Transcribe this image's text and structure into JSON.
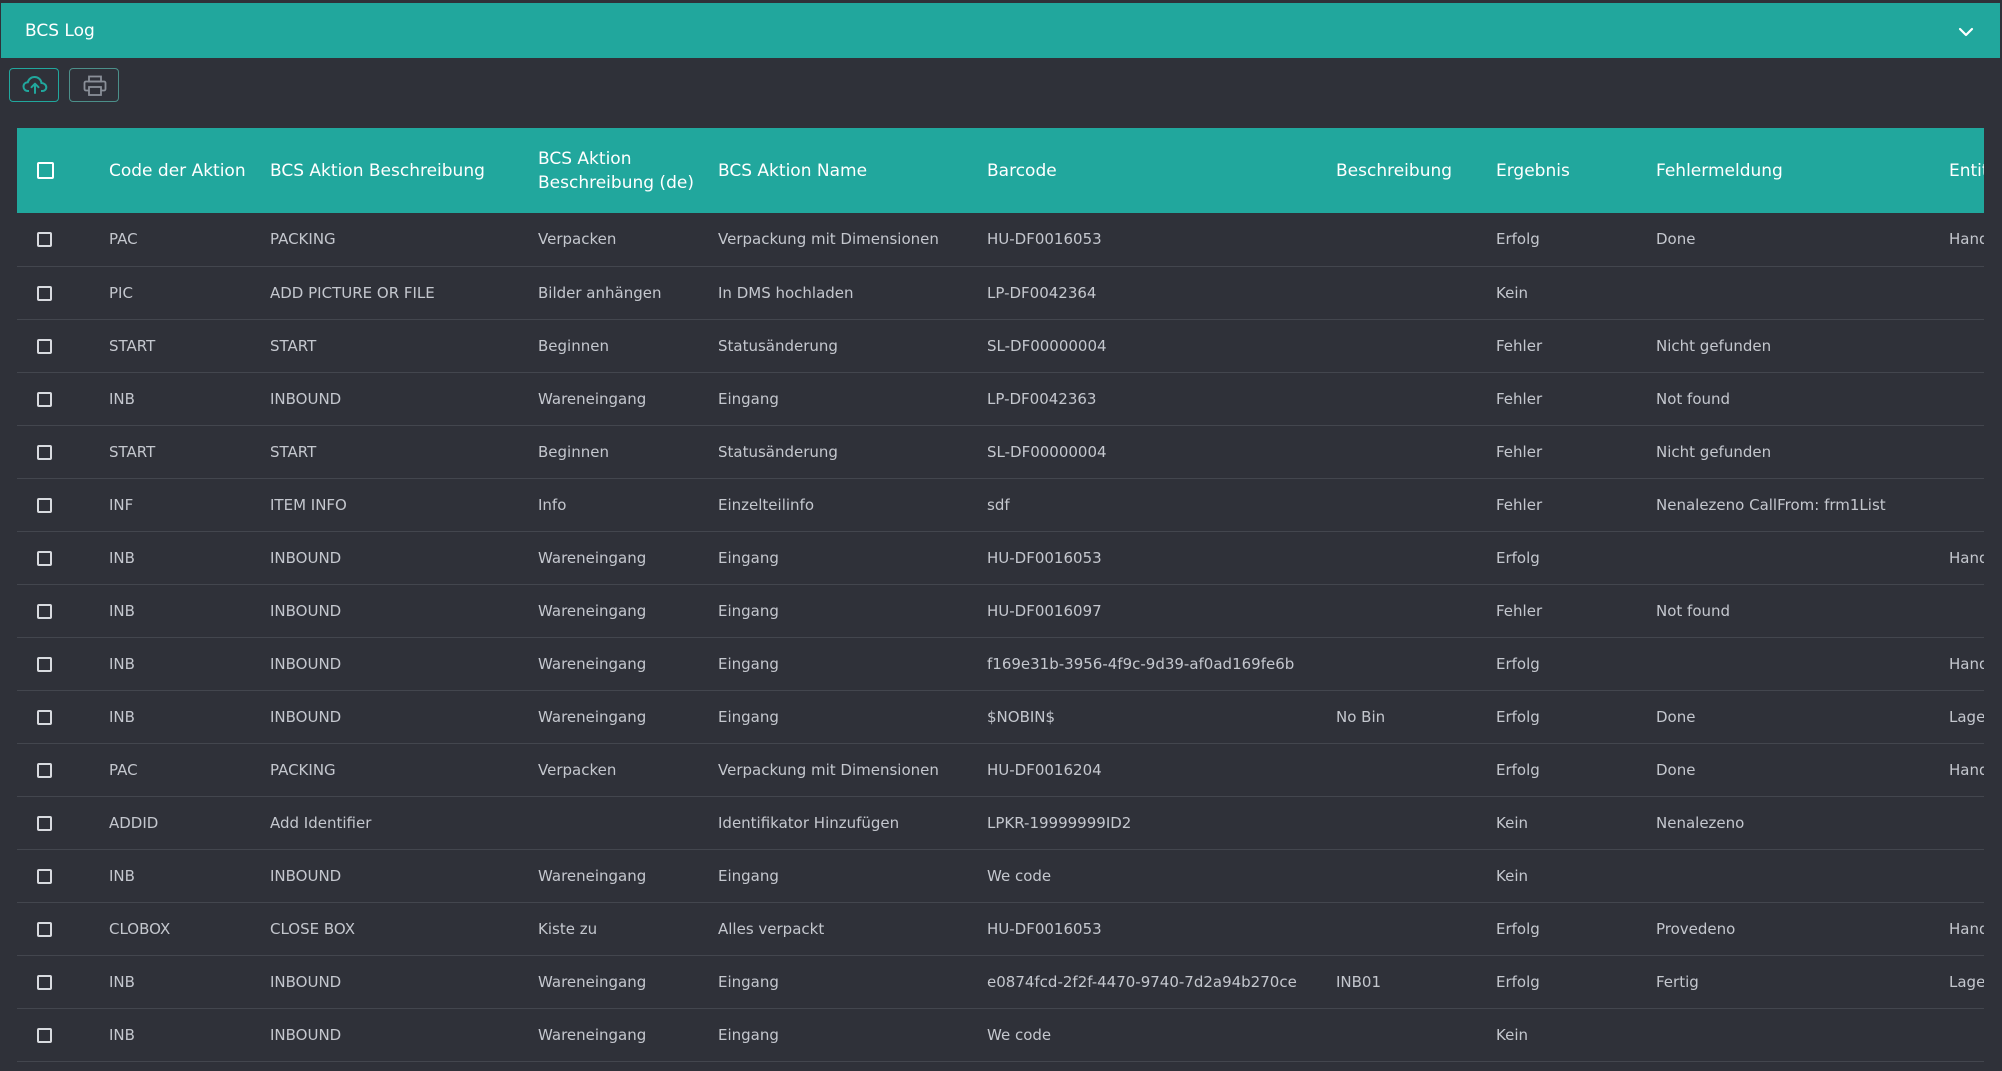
{
  "panel": {
    "title": "BCS Log"
  },
  "colors": {
    "accent": "#21a79d",
    "background": "#2f3139"
  },
  "toolbar": {
    "upload_icon": "cloud-upload-icon",
    "print_icon": "printer-icon"
  },
  "table": {
    "headers": [
      "Code der Aktion",
      "BCS Aktion Beschreibung",
      "BCS Aktion Beschreibung (de)",
      "BCS Aktion Name",
      "Barcode",
      "Beschreibung",
      "Ergebnis",
      "Fehlermeldung",
      "Entität"
    ],
    "rows": [
      [
        "PAC",
        "PACKING",
        "Verpacken",
        "Verpackung mit Dimensionen",
        "HU-DF0016053",
        "",
        "Erfolg",
        "Done",
        "Handling"
      ],
      [
        "PIC",
        "ADD PICTURE OR FILE",
        "Bilder anhängen",
        "In DMS hochladen",
        "LP-DF0042364",
        "",
        "Kein",
        "",
        ""
      ],
      [
        "START",
        "START",
        "Beginnen",
        "Statusänderung",
        "SL-DF00000004",
        "",
        "Fehler",
        "Nicht gefunden",
        ""
      ],
      [
        "INB",
        "INBOUND",
        "Wareneingang",
        "Eingang",
        "LP-DF0042363",
        "",
        "Fehler",
        "Not found",
        ""
      ],
      [
        "START",
        "START",
        "Beginnen",
        "Statusänderung",
        "SL-DF00000004",
        "",
        "Fehler",
        "Nicht gefunden",
        ""
      ],
      [
        "INF",
        "ITEM INFO",
        "Info",
        "Einzelteilinfo",
        "sdf",
        "",
        "Fehler",
        "Nenalezeno CallFrom: frm1List",
        ""
      ],
      [
        "INB",
        "INBOUND",
        "Wareneingang",
        "Eingang",
        "HU-DF0016053",
        "",
        "Erfolg",
        "",
        "Handling"
      ],
      [
        "INB",
        "INBOUND",
        "Wareneingang",
        "Eingang",
        "HU-DF0016097",
        "",
        "Fehler",
        "Not found",
        ""
      ],
      [
        "INB",
        "INBOUND",
        "Wareneingang",
        "Eingang",
        "f169e31b-3956-4f9c-9d39-af0ad169fe6b",
        "",
        "Erfolg",
        "",
        "Handling"
      ],
      [
        "INB",
        "INBOUND",
        "Wareneingang",
        "Eingang",
        "$NOBIN$",
        "No Bin",
        "Erfolg",
        "Done",
        "Lagerplatz"
      ],
      [
        "PAC",
        "PACKING",
        "Verpacken",
        "Verpackung mit Dimensionen",
        "HU-DF0016204",
        "",
        "Erfolg",
        "Done",
        "Handling"
      ],
      [
        "ADDID",
        "Add Identifier",
        "",
        "Identifikator Hinzufügen",
        "LPKR-19999999ID2",
        "",
        "Kein",
        "Nenalezeno",
        ""
      ],
      [
        "INB",
        "INBOUND",
        "Wareneingang",
        "Eingang",
        "We code",
        "",
        "Kein",
        "",
        ""
      ],
      [
        "CLOBOX",
        "CLOSE BOX",
        "Kiste zu",
        "Alles verpackt",
        "HU-DF0016053",
        "",
        "Erfolg",
        "Provedeno",
        "Handling"
      ],
      [
        "INB",
        "INBOUND",
        "Wareneingang",
        "Eingang",
        "e0874fcd-2f2f-4470-9740-7d2a94b270ce",
        "INB01",
        "Erfolg",
        "Fertig",
        "Lagerplatz"
      ],
      [
        "INB",
        "INBOUND",
        "Wareneingang",
        "Eingang",
        "We code",
        "",
        "Kein",
        "",
        ""
      ]
    ]
  }
}
